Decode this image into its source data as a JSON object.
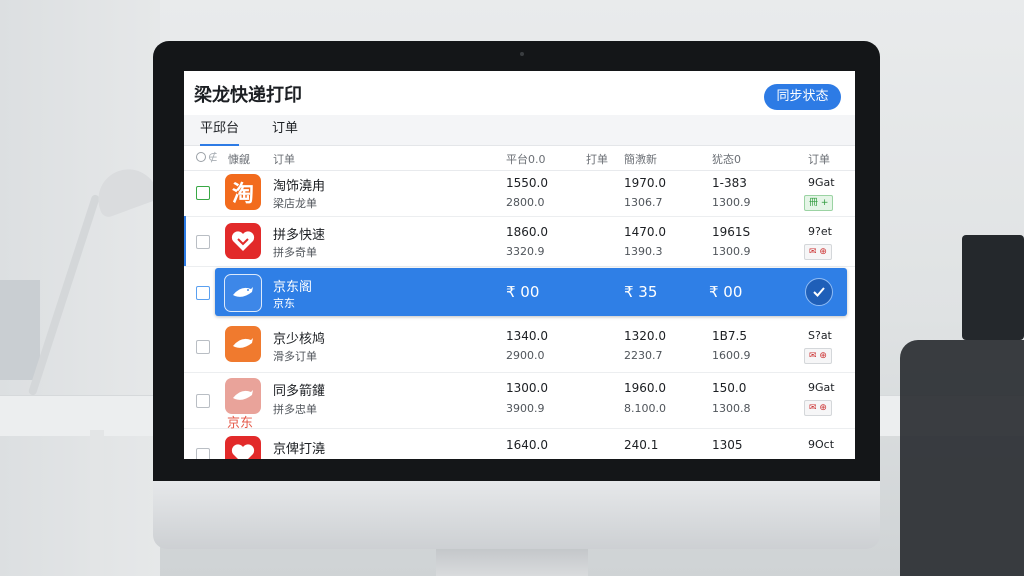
{
  "app": {
    "title": "梁龙快递打印",
    "sync_button": "同步状态"
  },
  "tabs": [
    {
      "label": "平邱台"
    },
    {
      "label": "订单"
    }
  ],
  "columns": {
    "icon_col": "ⓒ ∉",
    "logo": "慷觎",
    "order": "订单",
    "platform": "平台0.0",
    "print": "打单",
    "express": "簡漖新",
    "status": "犹态0",
    "detail": "订单"
  },
  "rows": [
    {
      "name": "淘饰澆甪",
      "sub": "梁店龙单",
      "col1": "1550.0",
      "col1b": "2800.0",
      "col2": "1970.0",
      "col2b": "1306.7",
      "col3": "1-383",
      "col3b": "1300.9",
      "status": "9Gat",
      "badge": "冊 +",
      "logo_char": "淘",
      "logo_icon": "taobao-logo-icon"
    },
    {
      "name": "拼多快速",
      "sub": "拼多奇单",
      "col1": "1860.0",
      "col1b": "3320.9",
      "col2": "1470.0",
      "col2b": "1390.3",
      "col3": "1961S",
      "col3b": "1300.9",
      "status": "9?et",
      "badge": "✉ ⊕",
      "logo_icon": "pinduoduo-logo-icon"
    },
    {
      "name": "京东阁",
      "sub": "京东",
      "val1": "₹ 00",
      "val2": "₹ 35",
      "val3": "₹ 00",
      "logo_icon": "jd-logo-icon"
    },
    {
      "name": "京少核鸠",
      "sub": "滑多订单",
      "col1": "1340.0",
      "col1b": "2900.0",
      "col2": "1320.0",
      "col2b": "2230.7",
      "col3": "1B7.5",
      "col3b": "1600.9",
      "status": "S?at",
      "badge": "✉ ⊕",
      "logo_icon": "jd-logo-icon"
    },
    {
      "name": "同多箭鑵",
      "sub": "拼多忠单",
      "col1": "1300.0",
      "col1b": "3900.9",
      "col2": "1960.0",
      "col2b": "8.100.0",
      "col3": "150.0",
      "col3b": "1300.8",
      "status": "9Gat",
      "badge": "✉ ⊕",
      "logo_icon": "jd-logo-icon",
      "logo_caption": "京东"
    },
    {
      "name": "京俾打澆",
      "sub": "",
      "col1": "1640.0",
      "col2": "240.1",
      "col3": "1305",
      "status": "9Oct",
      "logo_icon": "pinduoduo-logo-icon"
    }
  ],
  "colors": {
    "accent": "#2d7be5",
    "selected_row": "#2f7fe6",
    "taobao": "#f26b1d",
    "pdd": "#e22a2a"
  }
}
